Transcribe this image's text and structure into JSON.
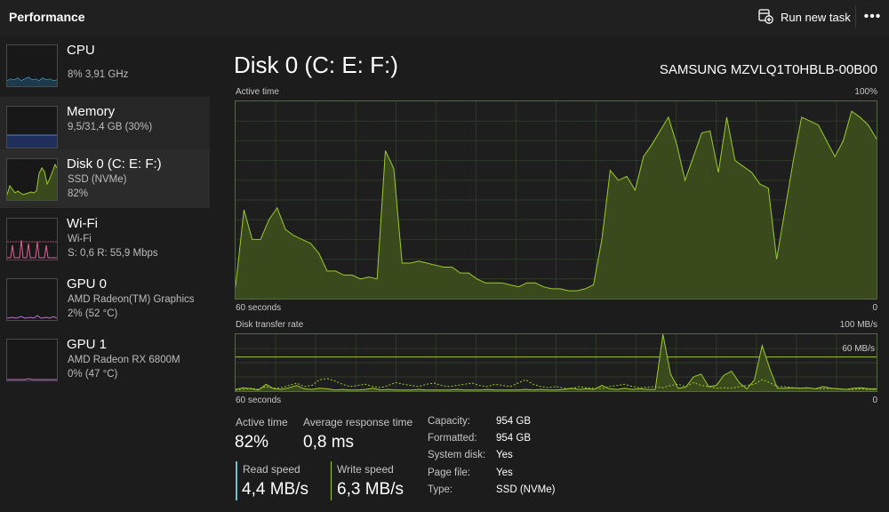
{
  "app": {
    "title": "Performance"
  },
  "toolbar": {
    "run_task_label": "Run new task",
    "more_label": "•••"
  },
  "sidebar": {
    "items": [
      {
        "name": "CPU",
        "sub1": "8%  3,91 GHz",
        "sub2": "",
        "color": "#4cc2ff",
        "selected": false
      },
      {
        "name": "Memory",
        "sub1": "9,5/31,4 GB (30%)",
        "sub2": "",
        "color": "#5b7fd0",
        "selected": false
      },
      {
        "name": "Disk 0 (C: E: F:)",
        "sub1": "SSD (NVMe)",
        "sub2": "82%",
        "color": "#9ccc2a",
        "selected": true
      },
      {
        "name": "Wi-Fi",
        "sub1": "Wi-Fi",
        "sub2": "S: 0,6  R: 55,9 Mbps",
        "color": "#e8609a",
        "selected": false
      },
      {
        "name": "GPU 0",
        "sub1": "AMD Radeon(TM) Graphics",
        "sub2": "2%  (52 °C)",
        "color": "#c470e0",
        "selected": false
      },
      {
        "name": "GPU 1",
        "sub1": "AMD Radeon RX 6800M",
        "sub2": "0%  (47 °C)",
        "color": "#c470e0",
        "selected": false
      }
    ]
  },
  "main": {
    "title": "Disk 0 (C: E: F:)",
    "model": "SAMSUNG MZVLQ1T0HBLB-00B00",
    "active_graph": {
      "label": "Active time",
      "max": "100%",
      "x_left": "60 seconds",
      "x_right": "0"
    },
    "transfer_graph": {
      "label": "Disk transfer rate",
      "max": "100 MB/s",
      "line_label": "60 MB/s",
      "x_left": "60 seconds",
      "x_right": "0"
    },
    "stats": {
      "active_time_label": "Active time",
      "active_time_value": "82%",
      "avg_response_label": "Average response time",
      "avg_response_value": "0,8 ms",
      "read_label": "Read speed",
      "read_value": "4,4 MB/s",
      "write_label": "Write speed",
      "write_value": "6,3 MB/s"
    },
    "properties": [
      {
        "key": "Capacity:",
        "value": "954 GB"
      },
      {
        "key": "Formatted:",
        "value": "954 GB"
      },
      {
        "key": "System disk:",
        "value": "Yes"
      },
      {
        "key": "Page file:",
        "value": "Yes"
      },
      {
        "key": "Type:",
        "value": "SSD (NVMe)"
      }
    ]
  },
  "colors": {
    "accent_green": "#9ccc2a",
    "graph_fill": "#3a4a1c",
    "graph_border": "#55674a",
    "read_bar": "#6fbfcf",
    "write_bar": "#9ccc2a"
  },
  "chart_data": [
    {
      "type": "area",
      "title": "Active time",
      "ylim": [
        0,
        100
      ],
      "x_range": [
        60,
        0
      ],
      "values": [
        6,
        45,
        30,
        30,
        40,
        46,
        35,
        32,
        30,
        28,
        23,
        14,
        14,
        12,
        12,
        10,
        11,
        10,
        75,
        66,
        18,
        18,
        19,
        18,
        17,
        16,
        16,
        13,
        13,
        10,
        8,
        8,
        8,
        7,
        6,
        8,
        8,
        6,
        5,
        5,
        4,
        4,
        5,
        7,
        30,
        65,
        60,
        62,
        55,
        72,
        78,
        85,
        92,
        78,
        60,
        72,
        84,
        85,
        64,
        92,
        70,
        67,
        64,
        58,
        56,
        20,
        45,
        70,
        92,
        90,
        88,
        80,
        72,
        80,
        95,
        92,
        88,
        81
      ]
    },
    {
      "type": "line",
      "title": "Disk transfer rate",
      "ylim": [
        0,
        100
      ],
      "x_range": [
        60,
        0
      ],
      "reference_line": 60,
      "series": [
        {
          "values": [
            3,
            6,
            4,
            2,
            12,
            4,
            3,
            6,
            10,
            4,
            3,
            5,
            4,
            2,
            3,
            2,
            2,
            3,
            5,
            2,
            3,
            2,
            2,
            2,
            3,
            2,
            2,
            2,
            2,
            3,
            2,
            2,
            2,
            3,
            2,
            2,
            2,
            2,
            3,
            2,
            3,
            2,
            2,
            3,
            5,
            3,
            4,
            3,
            10,
            4,
            3,
            5,
            3,
            4,
            3,
            3,
            100,
            30,
            5,
            7,
            25,
            30,
            8,
            10,
            28,
            35,
            15,
            4,
            20,
            80,
            40,
            5,
            5,
            6,
            5,
            6,
            4,
            8,
            5,
            4,
            3,
            5,
            6,
            4,
            4
          ]
        },
        {
          "values": [
            2,
            3,
            5,
            3,
            8,
            5,
            6,
            10,
            14,
            8,
            10,
            20,
            22,
            18,
            12,
            8,
            10,
            12,
            8,
            6,
            10,
            15,
            12,
            10,
            8,
            12,
            14,
            10,
            8,
            10,
            12,
            14,
            10,
            8,
            12,
            10,
            8,
            14,
            20,
            12,
            8,
            6,
            8,
            5,
            4,
            8,
            6,
            5,
            4,
            8,
            10,
            12,
            8,
            6,
            7,
            8,
            6,
            10,
            12,
            8,
            15,
            10,
            8,
            5,
            6,
            5,
            8,
            10,
            12,
            20,
            15,
            8,
            8,
            6,
            5,
            6,
            4,
            4,
            5,
            4,
            3,
            3,
            4,
            3,
            3
          ]
        }
      ]
    }
  ]
}
